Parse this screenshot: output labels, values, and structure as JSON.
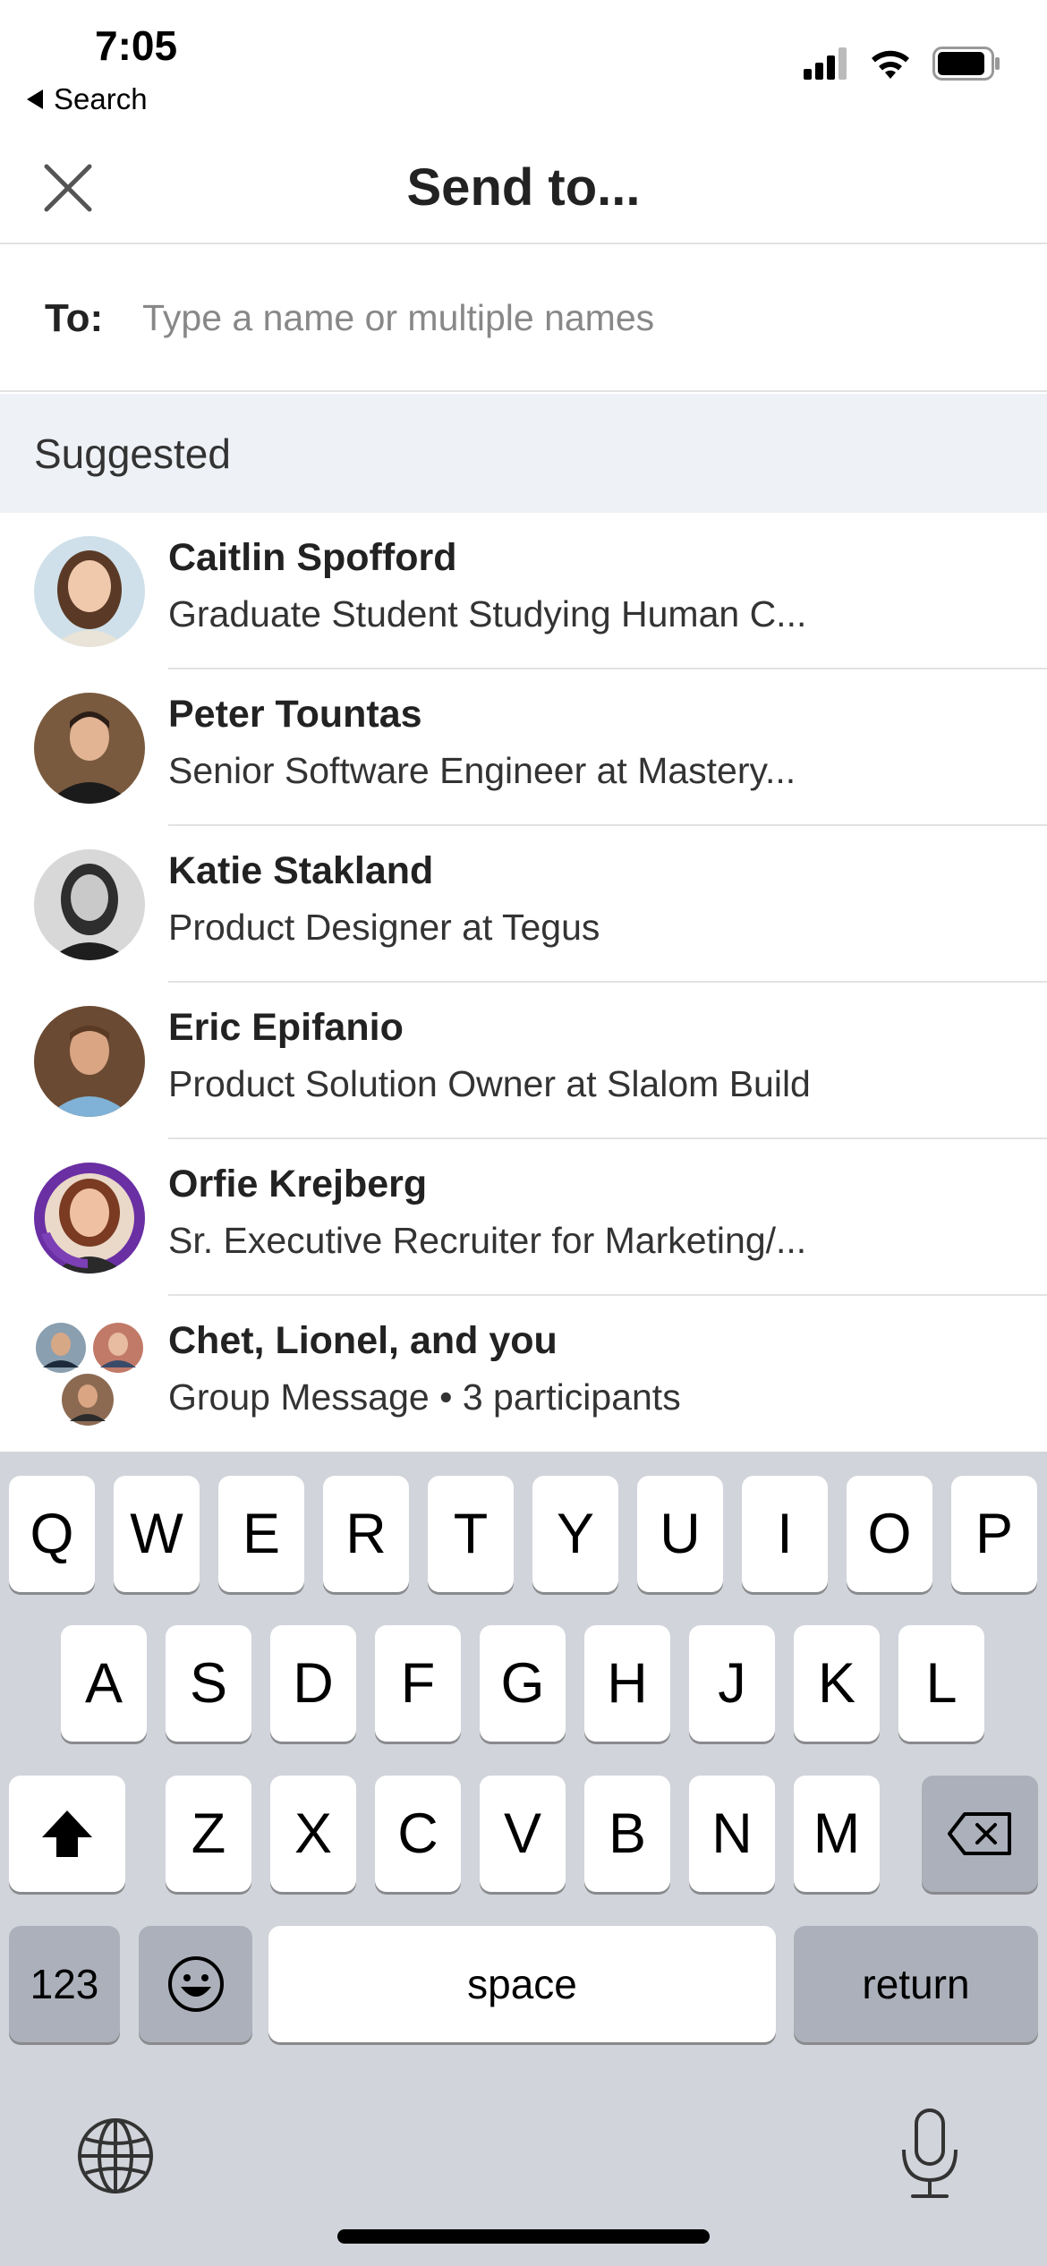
{
  "status_bar": {
    "time": "7:05",
    "back_label": "Search",
    "icons": [
      "cellular-signal-icon",
      "wifi-icon",
      "battery-icon"
    ]
  },
  "header": {
    "title": "Send to...",
    "close_icon": "close-icon"
  },
  "to_field": {
    "label": "To:",
    "placeholder": "Type a name or multiple names",
    "value": ""
  },
  "suggested": {
    "title": "Suggested",
    "contacts": [
      {
        "name": "Caitlin Spofford",
        "headline": "Graduate Student Studying Human C..."
      },
      {
        "name": "Peter Tountas",
        "headline": "Senior Software Engineer at Mastery..."
      },
      {
        "name": "Katie Stakland",
        "headline": "Product Designer at Tegus"
      },
      {
        "name": "Eric Epifanio",
        "headline": "Product Solution Owner at Slalom Build"
      },
      {
        "name": "Orfie Krejberg",
        "headline": "Sr. Executive Recruiter for Marketing/..."
      },
      {
        "name": "Chet, Lionel, and you",
        "headline": "Group Message • 3 participants"
      }
    ]
  },
  "keyboard": {
    "row1": [
      "Q",
      "W",
      "E",
      "R",
      "T",
      "Y",
      "U",
      "I",
      "O",
      "P"
    ],
    "row2": [
      "A",
      "S",
      "D",
      "F",
      "G",
      "H",
      "J",
      "K",
      "L"
    ],
    "row3": [
      "Z",
      "X",
      "C",
      "V",
      "B",
      "N",
      "M"
    ],
    "numbers_label": "123",
    "space_label": "space",
    "return_label": "return",
    "colors": {
      "background": "#d1d4da",
      "key": "#ffffff",
      "dark_key": "#abb0ba"
    }
  },
  "colors": {
    "section_background": "#eef2f6",
    "divider": "#e2e2e2",
    "text_primary": "#222222",
    "placeholder": "#888888"
  }
}
